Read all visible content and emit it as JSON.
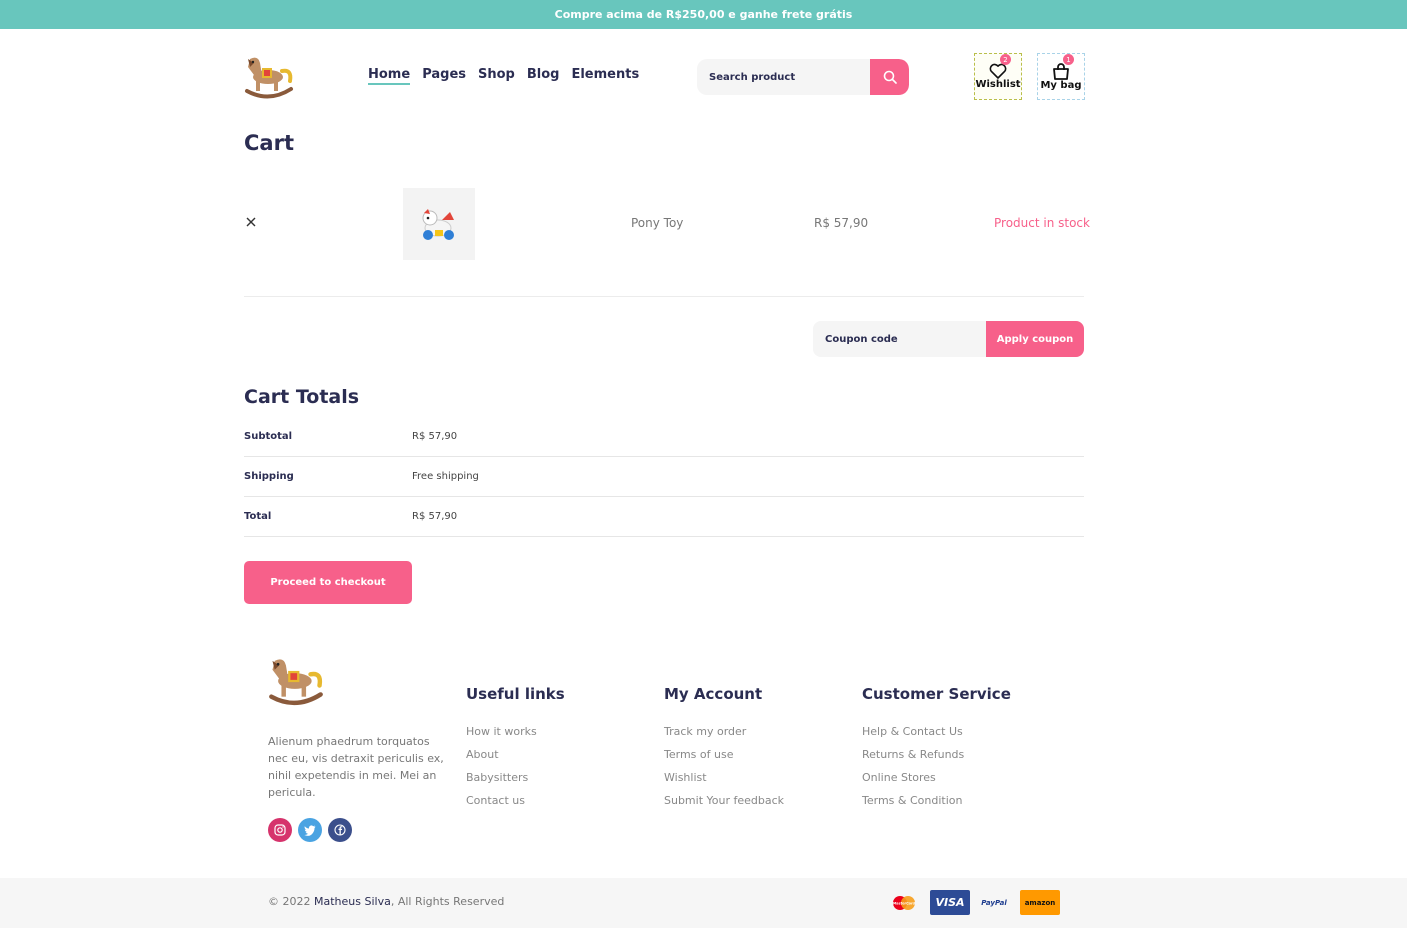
{
  "topbar": {
    "promo": "Compre acima de R$250,00 e ganhe frete grátis"
  },
  "header": {
    "nav": [
      {
        "label": "Home",
        "active": true
      },
      {
        "label": "Pages"
      },
      {
        "label": "Shop"
      },
      {
        "label": "Blog"
      },
      {
        "label": "Elements"
      }
    ],
    "search": {
      "placeholder": "Search product",
      "icon": "search-icon"
    },
    "wishlist": {
      "label": "Wishlist",
      "count": "2",
      "icon": "heart-icon"
    },
    "bag": {
      "label": "My bag",
      "count": "1",
      "icon": "shopping-bag-icon"
    }
  },
  "cart": {
    "title": "Cart",
    "items": [
      {
        "name": "Pony Toy",
        "price": "R$ 57,90",
        "stock": "Product in stock"
      }
    ],
    "coupon": {
      "placeholder": "Coupon code",
      "button": "Apply coupon"
    }
  },
  "totals": {
    "title": "Cart Totals",
    "rows": [
      {
        "label": "Subtotal",
        "value": "R$ 57,90"
      },
      {
        "label": "Shipping",
        "value": "Free shipping"
      },
      {
        "label": "Total",
        "value": "R$ 57,90"
      }
    ],
    "checkout": "Proceed to checkout"
  },
  "footer": {
    "about": "Alienum phaedrum torquatos nec eu, vis detraxit periculis ex, nihil expetendis in mei. Mei an pericula.",
    "social": [
      "instagram-icon",
      "twitter-icon",
      "facebook-icon"
    ],
    "columns": [
      {
        "title": "Useful links",
        "links": [
          "How it works",
          "About",
          "Babysitters",
          "Contact us"
        ]
      },
      {
        "title": "My Account",
        "links": [
          "Track my order",
          "Terms of use",
          "Wishlist",
          "Submit Your feedback"
        ]
      },
      {
        "title": "Customer Service",
        "links": [
          "Help & Contact Us",
          "Returns & Refunds",
          "Online Stores",
          "Terms & Condition"
        ]
      }
    ],
    "copyright_prefix": "© 2022 ",
    "copyright_name": "Matheus Silva",
    "copyright_suffix": ", All Rights Reserved",
    "payments": [
      "MasterCard",
      "VISA",
      "PayPal",
      "amazon"
    ]
  },
  "colors": {
    "accent": "#f7608a",
    "teal": "#68c6bd",
    "navy": "#2b2d52"
  }
}
